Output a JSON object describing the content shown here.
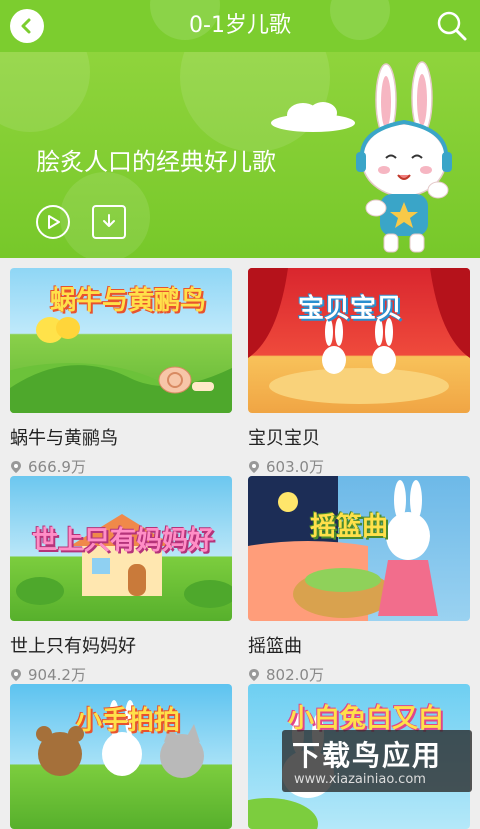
{
  "header": {
    "title": "0-1岁儿歌",
    "back_icon": "chevron-left-icon",
    "search_icon": "search-icon",
    "accent": "#7ccd2f"
  },
  "banner": {
    "text": "脍炙人口的经典好儿歌",
    "play_icon": "play-icon",
    "download_icon": "download-icon"
  },
  "songs": [
    {
      "title": "蜗牛与黄鹂鸟",
      "count": "666.9万",
      "thumb_label": "蜗牛与黄鹂鸟"
    },
    {
      "title": "宝贝宝贝",
      "count": "603.0万",
      "thumb_label": "宝贝宝贝"
    },
    {
      "title": "世上只有妈妈好",
      "count": "904.2万",
      "thumb_label": "世上只有妈妈好"
    },
    {
      "title": "摇篮曲",
      "count": "802.0万",
      "thumb_label": "摇篮曲"
    },
    {
      "title": "",
      "count": "",
      "thumb_label": "小手拍拍"
    },
    {
      "title": "",
      "count": "",
      "thumb_label": "小白兔白又白"
    }
  ],
  "watermark": {
    "main": "下载鸟应用",
    "url": "www.xiazainiao.com"
  }
}
